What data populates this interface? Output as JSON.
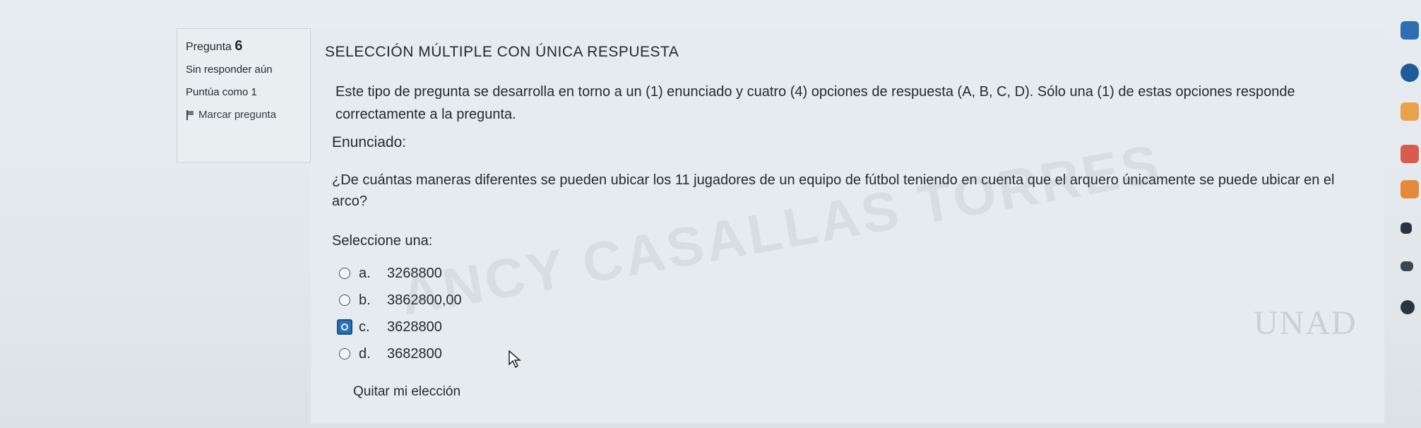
{
  "info": {
    "question_label": "Pregunta",
    "question_number": "6",
    "status": "Sin responder aún",
    "score": "Puntúa como 1",
    "flag_label": "Marcar pregunta"
  },
  "question": {
    "title": "Selección múltiple con única respuesta",
    "instructions": "Este tipo de pregunta se desarrolla en torno a un (1) enunciado y cuatro (4) opciones de respuesta (A, B, C, D). Sólo una (1) de estas opciones responde correctamente a la pregunta.",
    "enunciado_label": "Enunciado:",
    "text": "¿De cuántas maneras diferentes se pueden ubicar los 11 jugadores de un equipo de fútbol teniendo en cuenta que el arquero únicamente se puede ubicar en el arco?",
    "select_label": "Seleccione una:",
    "options": [
      {
        "letter": "a.",
        "value": "3268800"
      },
      {
        "letter": "b.",
        "value": "3862800,00"
      },
      {
        "letter": "c.",
        "value": "3628800"
      },
      {
        "letter": "d.",
        "value": "3682800"
      }
    ],
    "selected_option": "c.",
    "clear_label": "Quitar mi elección"
  },
  "watermark": "ANCY CASALLAS TORRES",
  "logo": "UNAD",
  "side_icons": [
    "home-icon",
    "reader-icon",
    "calendar-icon",
    "mail-icon",
    "chat-icon",
    "expand-icon",
    "back-icon",
    "help-icon"
  ],
  "colors": {
    "selected_radio": "#2b6fb3",
    "page_bg": "#e5ebef"
  }
}
